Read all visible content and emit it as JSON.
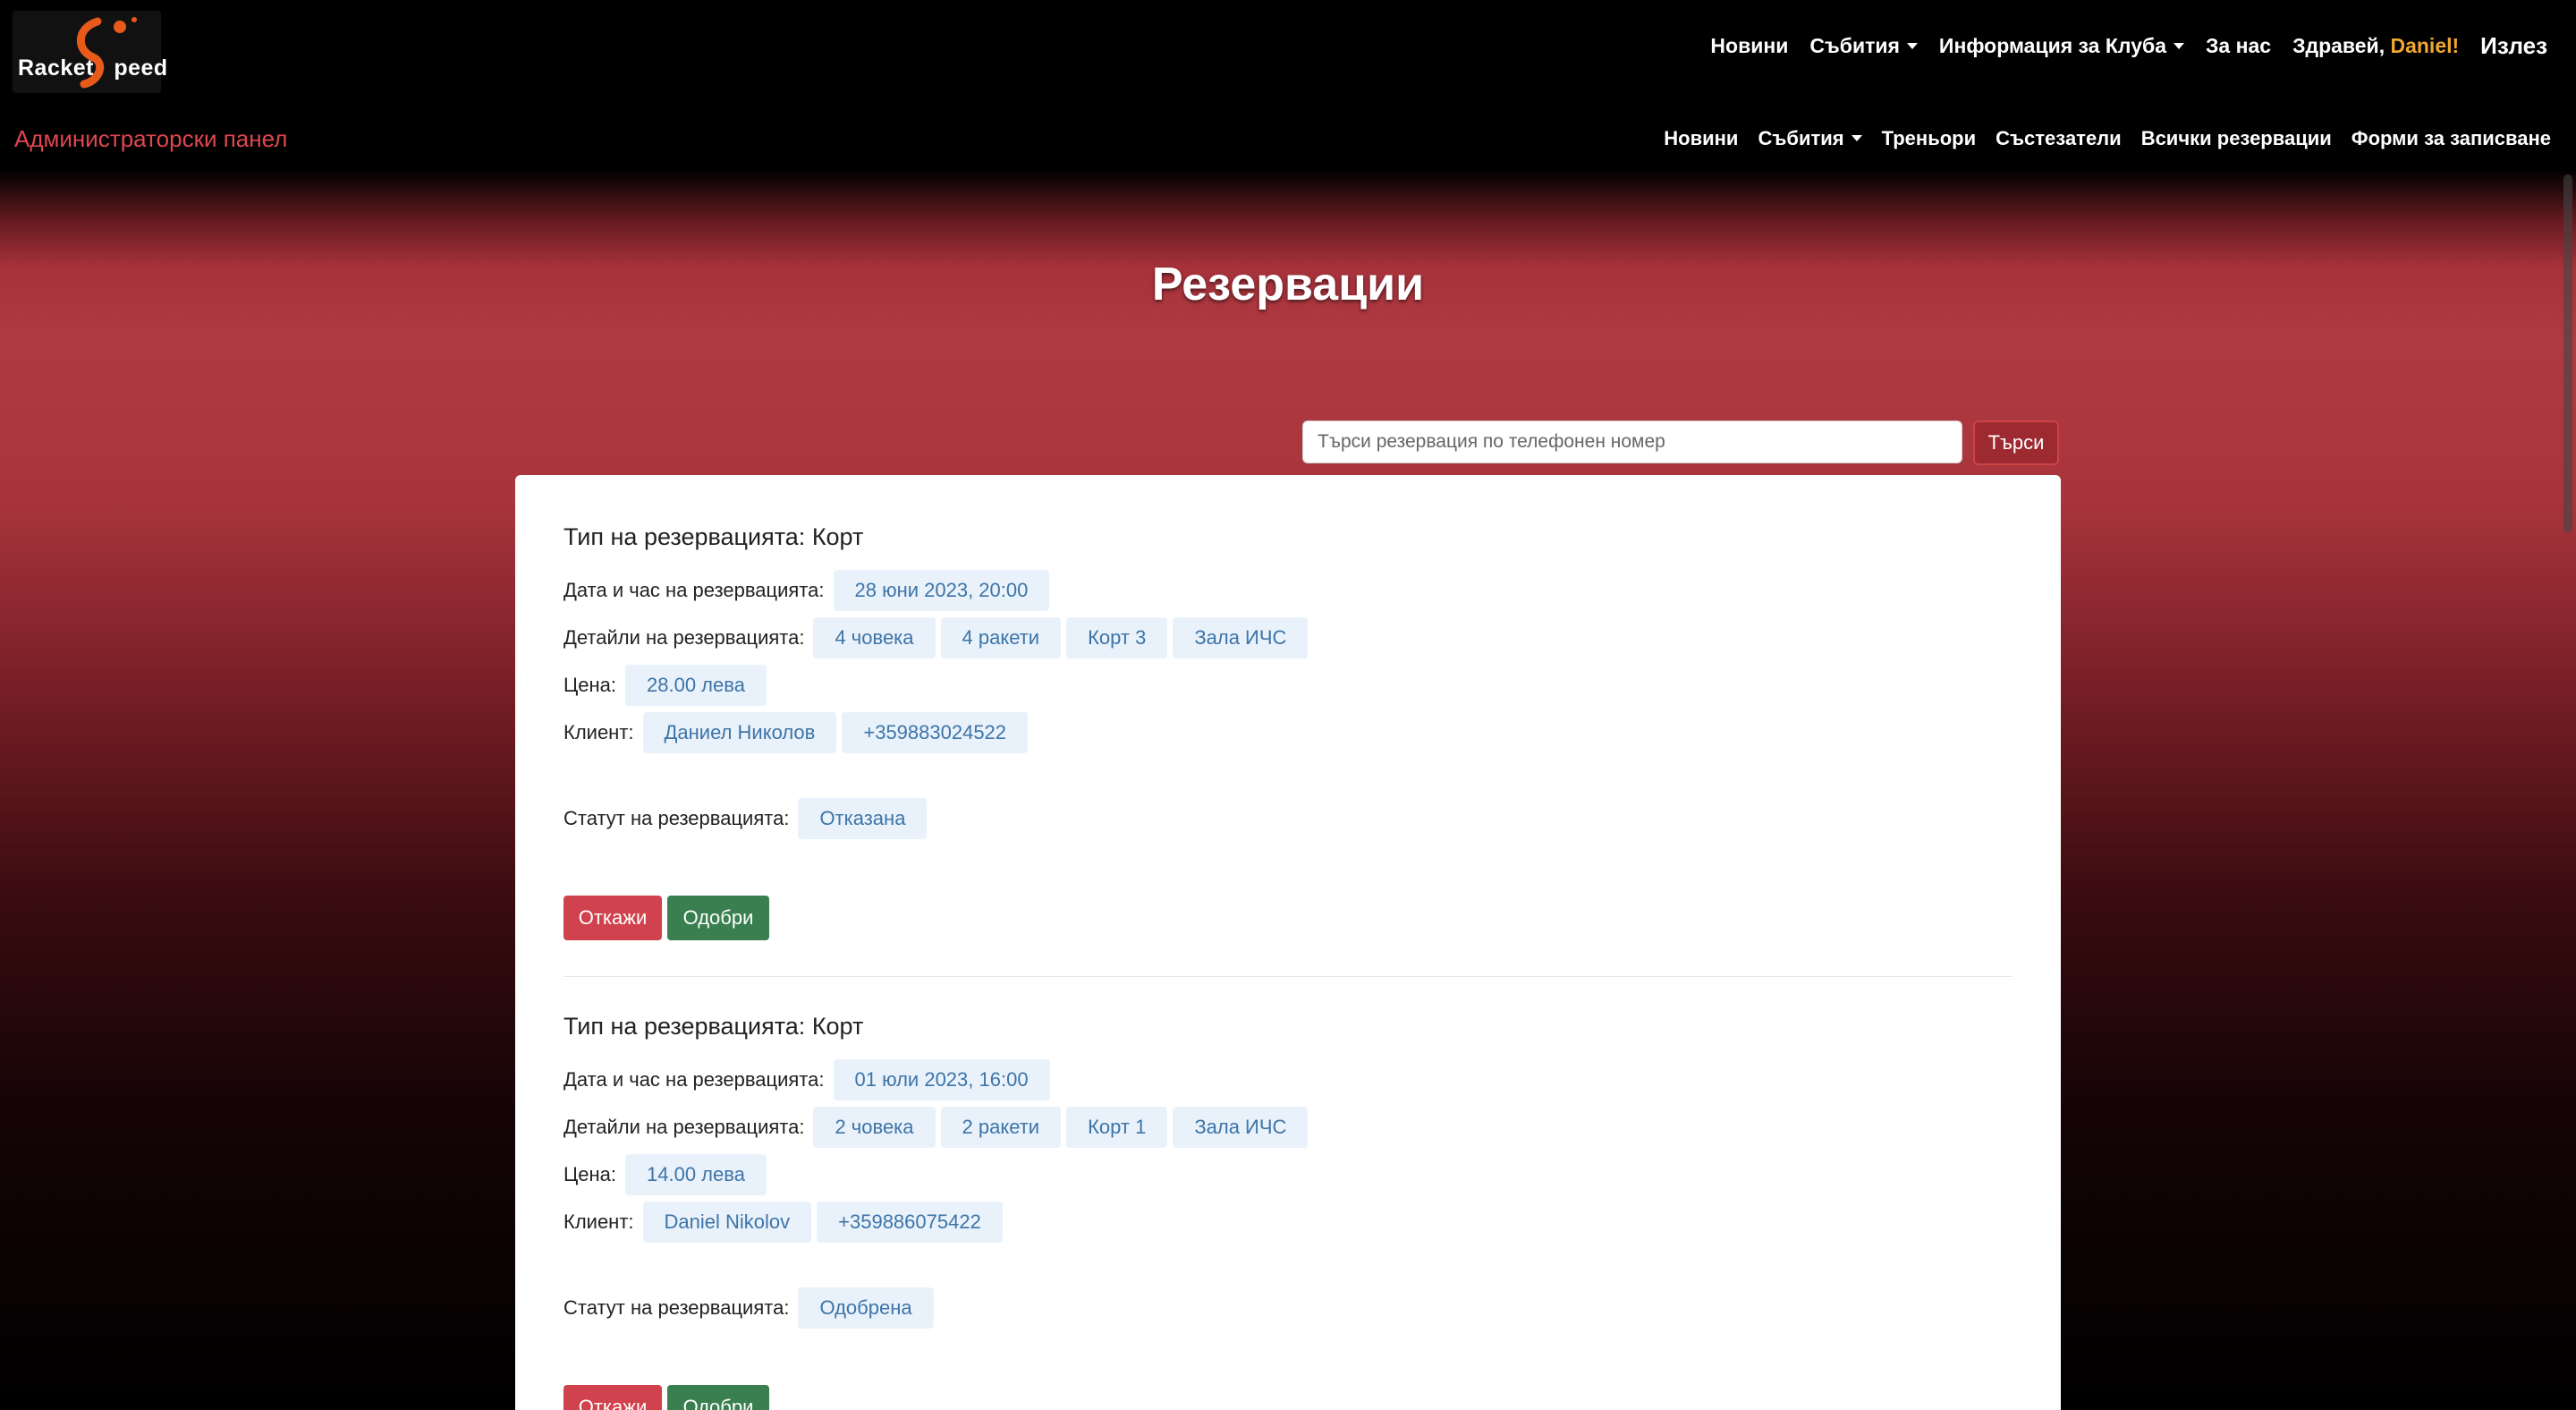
{
  "brand": {
    "logo_text": "RacketSpeed",
    "logo_part1": "Racket",
    "logo_part2": "peed",
    "accent": "#e0464f",
    "greet_name_color": "#f0a830"
  },
  "nav_top": {
    "news": "Новини",
    "events": "Събития",
    "club_info": "Информация за Клуба",
    "about": "За нас",
    "greeting": "Здравей,",
    "user_name": "Daniel!",
    "logout": "Излез"
  },
  "admin_nav": {
    "title": "Администраторски панел",
    "news": "Новини",
    "events": "Събития",
    "trainers": "Треньори",
    "competitors": "Състезатели",
    "all_reservations": "Всички резервации",
    "signup_forms": "Форми за записване"
  },
  "page": {
    "title": "Резервации"
  },
  "search": {
    "placeholder": "Търси резервация по телефонен номер",
    "button": "Търси"
  },
  "labels": {
    "type_prefix": "Тип на резервацията:",
    "datetime": "Дата и час на резервацията:",
    "details": "Детайли на резервацията:",
    "price": "Цена:",
    "client": "Клиент:",
    "status": "Статут на резервацията:",
    "reject": "Откажи",
    "approve": "Одобри"
  },
  "reservations": [
    {
      "type": "Корт",
      "datetime": "28 юни 2023, 20:00",
      "details": [
        "4 човека",
        "4 ракети",
        "Корт 3",
        "Зала ИЧС"
      ],
      "price": "28.00 лева",
      "client_name": "Даниел Николов",
      "client_phone": "+359883024522",
      "status": "Отказана"
    },
    {
      "type": "Корт",
      "datetime": "01 юли 2023, 16:00",
      "details": [
        "2 човека",
        "2 ракети",
        "Корт 1",
        "Зала ИЧС"
      ],
      "price": "14.00 лева",
      "client_name": "Daniel Nikolov",
      "client_phone": "+359886075422",
      "status": "Одобрена"
    }
  ]
}
